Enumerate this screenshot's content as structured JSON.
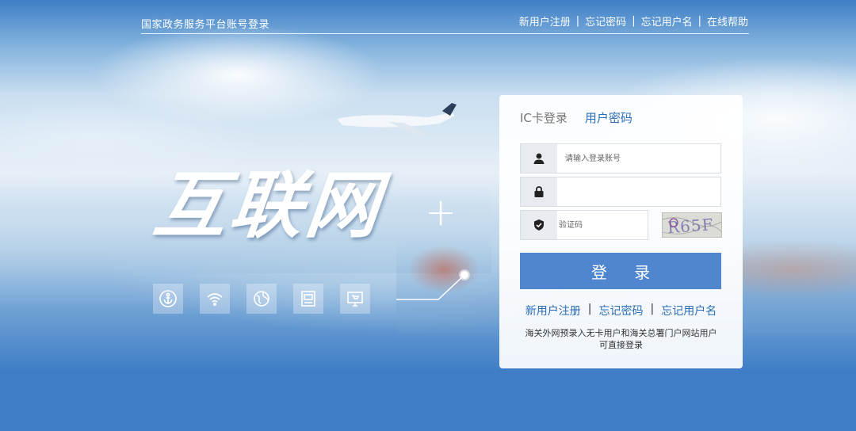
{
  "header": {
    "title": "国家政务服务平台账号登录",
    "links": [
      "新用户注册",
      "忘记密码",
      "忘记用户名",
      "在线帮助"
    ],
    "separator": "|"
  },
  "brand": {
    "text": "互联网",
    "plus": "+"
  },
  "feature_icons": [
    "anchor-icon",
    "wifi-icon",
    "globe-icon",
    "container-icon",
    "cart-monitor-icon"
  ],
  "login": {
    "tabs": [
      {
        "label": "IC卡登录",
        "active": false
      },
      {
        "label": "用户密码",
        "active": true
      }
    ],
    "username": {
      "placeholder": "请输入登录账号",
      "value": ""
    },
    "password": {
      "placeholder": "",
      "value": ""
    },
    "captcha": {
      "placeholder": "验证码",
      "value": "",
      "image_text": "R65F"
    },
    "submit_label": "登 录",
    "links": [
      "新用户注册",
      "忘记密码",
      "忘记用户名"
    ],
    "separator": "|",
    "note": [
      "海关外网预录入无卡用户和海关总署门户网站用户",
      "可直接登录"
    ]
  },
  "colors": {
    "accent": "#2a6db5",
    "button": "#4f86cf",
    "background": "#4a86c8"
  }
}
